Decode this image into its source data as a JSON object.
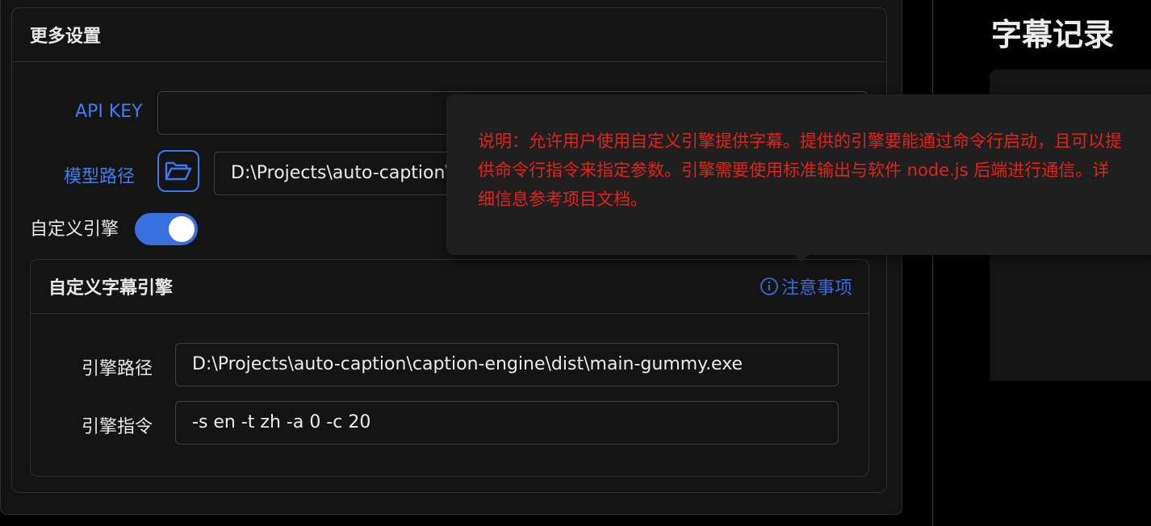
{
  "settings": {
    "title": "更多设置",
    "api_key_label": "API KEY",
    "api_key_value": "",
    "model_path_label": "模型路径",
    "model_path_value": "D:\\Projects\\auto-caption\\",
    "custom_engine_label": "自定义引擎",
    "custom_engine_enabled": true
  },
  "engine": {
    "title": "自定义字幕引擎",
    "notice_label": "注意事项",
    "path_label": "引擎路径",
    "path_value": "D:\\Projects\\auto-caption\\caption-engine\\dist\\main-gummy.exe",
    "command_label": "引擎指令",
    "command_value": "-s en -t zh -a 0 -c 20"
  },
  "tooltip": {
    "text": "说明：允许用户使用自定义引擎提供字幕。提供的引擎要能通过命令行启动，且可以提供命令行指令来指定参数。引擎需要使用标准输出与软件 node.js 后端进行通信。详细信息参考项目文档。"
  },
  "caption_records": {
    "title": "字幕记录"
  },
  "colors": {
    "accent": "#3a6fe0",
    "tooltip_text": "#e0241c",
    "background": "#000000",
    "panel": "#141414"
  },
  "icons": {
    "folder": "folder-open-icon",
    "info": "info-circle-icon"
  }
}
